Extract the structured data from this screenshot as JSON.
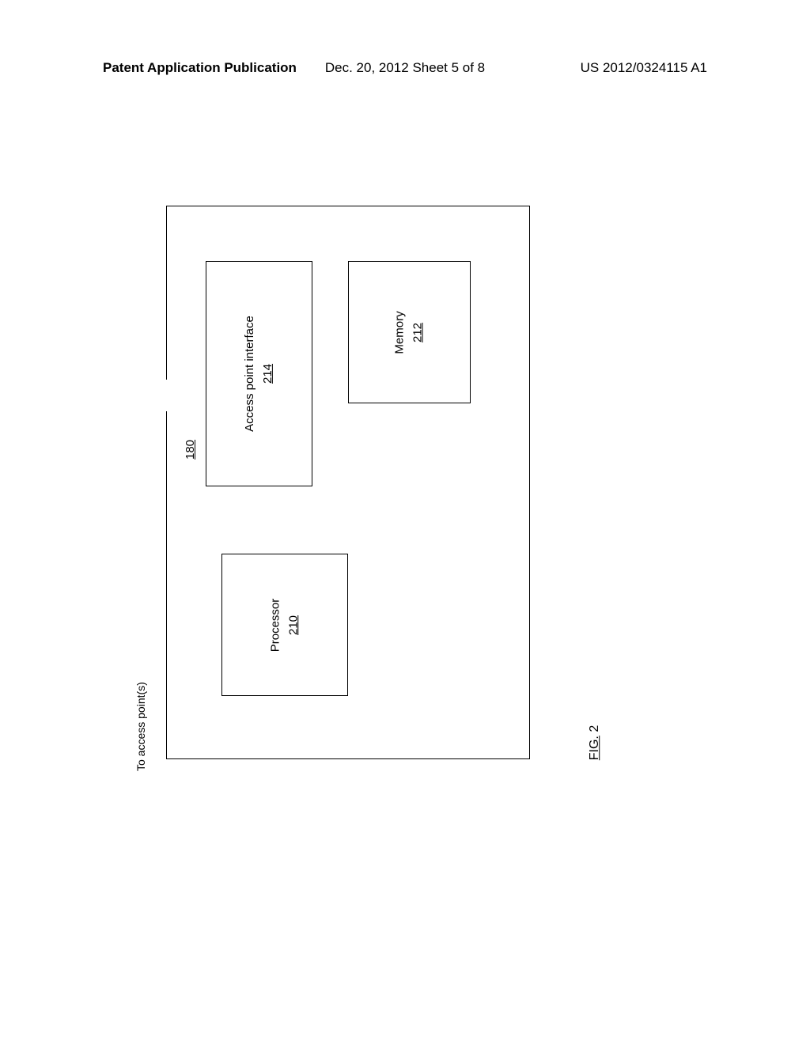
{
  "header": {
    "left": "Patent Application Publication",
    "center": "Dec. 20, 2012  Sheet 5 of 8",
    "right": "US 2012/0324115 A1"
  },
  "figure": {
    "label_prefix": "FIG.",
    "label_num": "2",
    "container_ref": "180",
    "external_label": "To access point(s)"
  },
  "blocks": {
    "processor": {
      "name": "Processor",
      "ref": "210"
    },
    "memory": {
      "name": "Memory",
      "ref": "212"
    },
    "api": {
      "name": "Access point interface",
      "ref": "214"
    }
  }
}
